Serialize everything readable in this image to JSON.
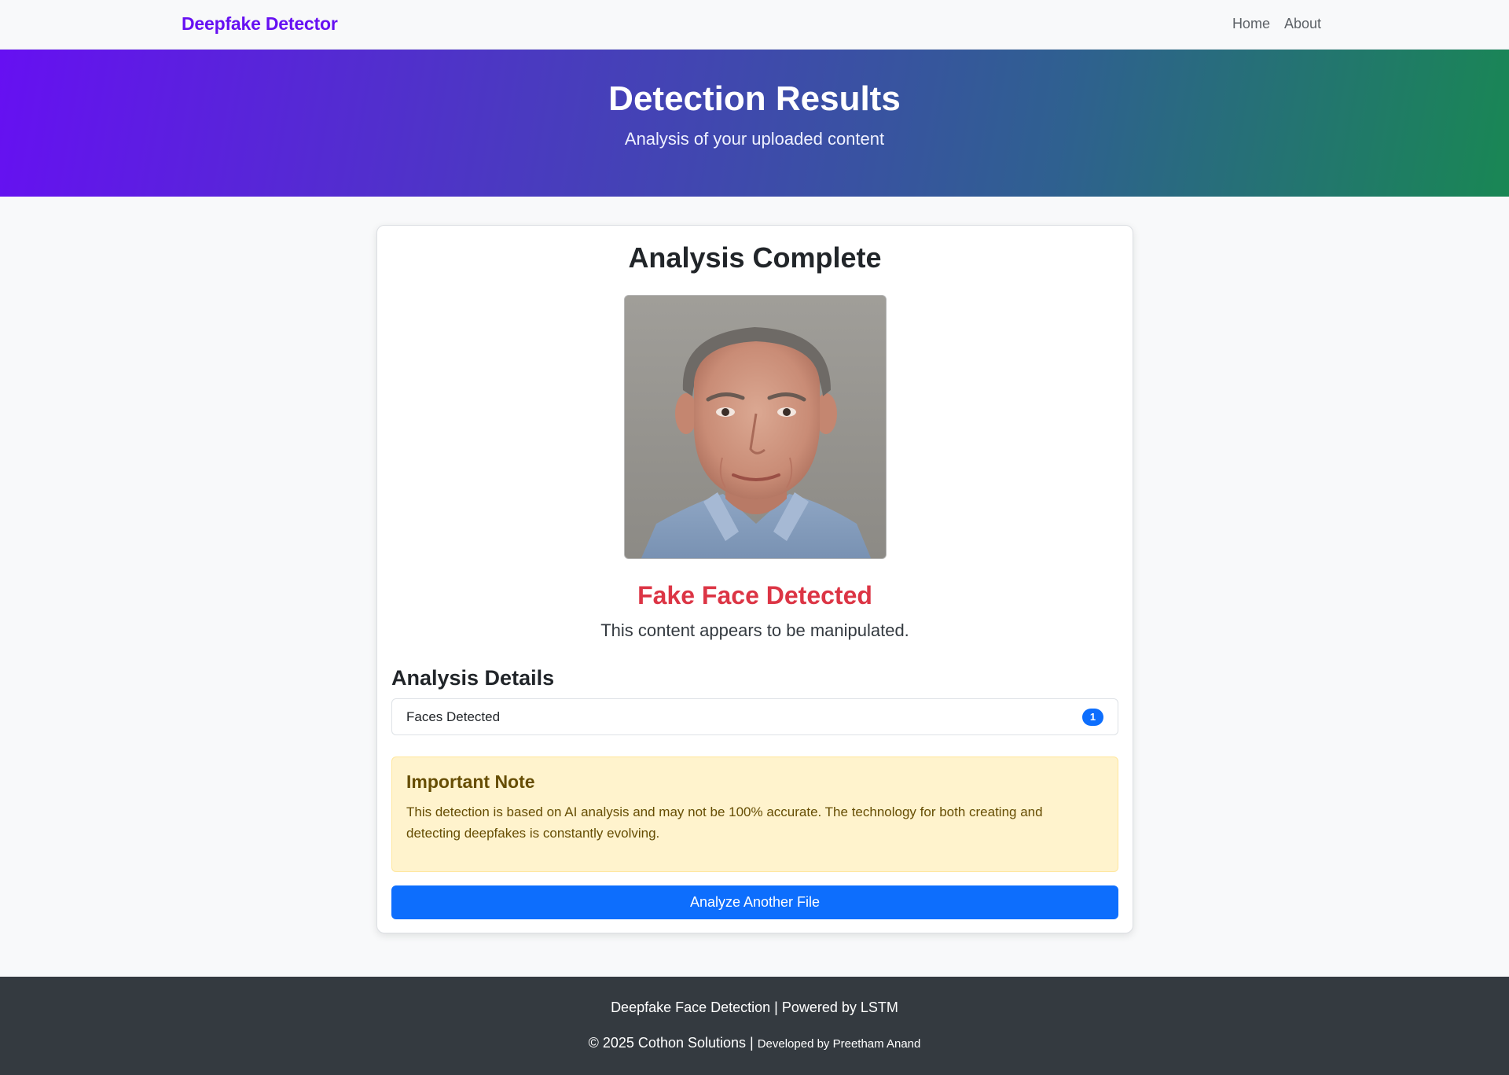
{
  "navbar": {
    "brand": "Deepfake Detector",
    "links": [
      "Home",
      "About"
    ]
  },
  "hero": {
    "title": "Detection Results",
    "subtitle": "Analysis of your uploaded content"
  },
  "card": {
    "title": "Analysis Complete",
    "result_title": "Fake Face Detected",
    "result_text": "This content appears to be manipulated.",
    "details_title": "Analysis Details",
    "details": [
      {
        "label": "Faces Detected",
        "value": "1"
      }
    ],
    "note_title": "Important Note",
    "note_text": "This detection is based on AI analysis and may not be 100% accurate. The technology for both creating and detecting deepfakes is constantly evolving.",
    "action_label": "Analyze Another File"
  },
  "footer": {
    "line1": "Deepfake Face Detection | Powered by LSTM",
    "line2_main": "© 2025 Cothon Solutions | ",
    "line2_small": "Developed by Preetham Anand"
  },
  "colors": {
    "brand": "#6610f2",
    "hero_gradient_start": "#6610f2",
    "hero_gradient_end": "#198754",
    "fake_result": "#dc3545",
    "primary": "#0d6efd",
    "warning_bg": "#fff3cd",
    "footer_bg": "#343a40"
  }
}
